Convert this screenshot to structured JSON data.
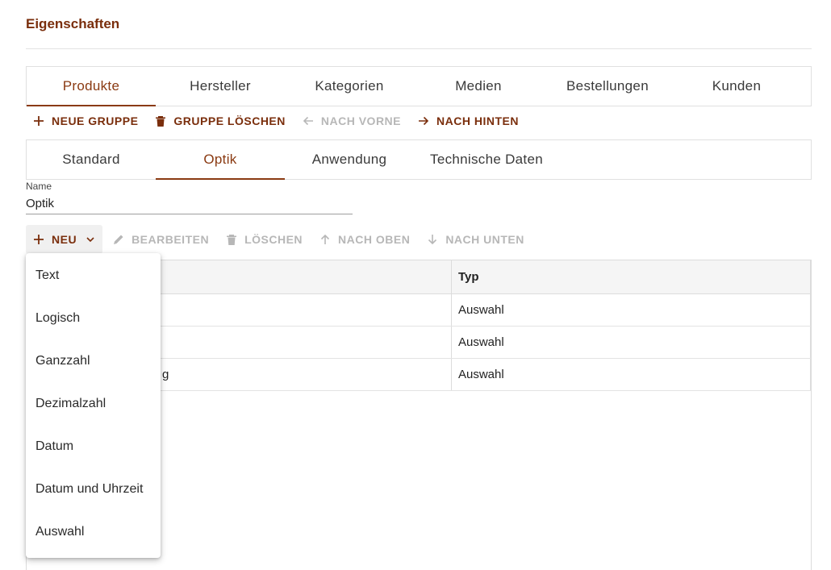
{
  "page": {
    "title": "Eigenschaften"
  },
  "main_tabs": [
    {
      "label": "Produkte",
      "active": true
    },
    {
      "label": "Hersteller"
    },
    {
      "label": "Kategorien"
    },
    {
      "label": "Medien"
    },
    {
      "label": "Bestellungen"
    },
    {
      "label": "Kunden"
    }
  ],
  "group_toolbar": {
    "new_group": "NEUE GRUPPE",
    "delete_group": "GRUPPE LÖSCHEN",
    "move_forward": "NACH VORNE",
    "move_back": "NACH HINTEN"
  },
  "group_tabs": [
    {
      "label": "Standard"
    },
    {
      "label": "Optik",
      "active": true
    },
    {
      "label": "Anwendung"
    },
    {
      "label": "Technische Daten"
    }
  ],
  "name_field": {
    "label": "Name",
    "value": "Optik"
  },
  "property_toolbar": {
    "new": "NEU",
    "edit": "BEARBEITEN",
    "delete": "LÖSCHEN",
    "move_up": "NACH OBEN",
    "move_down": "NACH UNTEN"
  },
  "table": {
    "columns": [
      "",
      "Typ"
    ],
    "rows": [
      [
        "",
        "Auswahl"
      ],
      [
        "",
        "Auswahl"
      ],
      [
        "g",
        "Auswahl"
      ]
    ]
  },
  "new_menu": {
    "items": [
      "Text",
      "Logisch",
      "Ganzzahl",
      "Dezimalzahl",
      "Datum",
      "Datum und Uhrzeit",
      "Auswahl"
    ]
  },
  "colors": {
    "accent": "#7a2e0c",
    "disabled": "#b7b7b7",
    "header_bg": "#f5f5f5"
  }
}
